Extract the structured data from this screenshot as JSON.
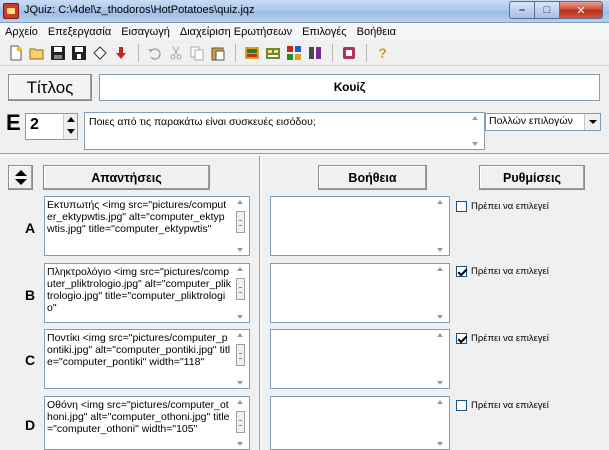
{
  "window": {
    "title": "JQuiz: C:\\4del\\z_thodoros\\HotPotatoes\\quiz.jqz",
    "min_label": "–",
    "max_label": "□",
    "close_label": "✕"
  },
  "menu": {
    "items": [
      {
        "label": "Αρχείο"
      },
      {
        "label": "Επεξεργασία"
      },
      {
        "label": "Εισαγωγή"
      },
      {
        "label": "Διαχείριση Ερωτήσεων"
      },
      {
        "label": "Επιλογές"
      },
      {
        "label": "Βοήθεια"
      }
    ]
  },
  "toolbar": {
    "icons": [
      "new-icon",
      "open-icon",
      "save-icon",
      "save-as-icon",
      "web-page-icon",
      "upload-icon",
      "undo-icon",
      "cut-icon",
      "copy-icon",
      "paste-icon",
      "export-icon",
      "config-icon",
      "hot-potatoes-icon",
      "masher-icon",
      "help-book-icon",
      "help-question-icon"
    ],
    "help_label": "?"
  },
  "title_row": {
    "label": "Τίτλος",
    "value": "Κουίζ"
  },
  "question": {
    "letter": "E",
    "number": "2",
    "text": "Ποιες από τις παρακάτω είναι συσκευές εισόδου;",
    "type": "Πολλών επιλογών"
  },
  "headers": {
    "answers": "Απαντήσεις",
    "feedback": "Βοήθεια",
    "settings": "Ρυθμίσεις"
  },
  "answers": [
    {
      "letter": "A",
      "text": "Εκτυπωτής <img src=\"pictures/computer_ektypwtis.jpg\" alt=\"computer_ektypwtis.jpg\" title=\"computer_ektypwtis\"",
      "feedback": "",
      "correct_label": "Πρέπει να επιλεγεί",
      "correct": false
    },
    {
      "letter": "B",
      "text": "Πληκτρολόγιο <img src=\"pictures/computer_pliktrologio.jpg\" alt=\"computer_pliktrologio.jpg\" title=\"computer_pliktrologio\"",
      "feedback": "",
      "correct_label": "Πρέπει να επιλεγεί",
      "correct": true
    },
    {
      "letter": "C",
      "text": "Ποντίκι <img src=\"pictures/computer_pontiki.jpg\" alt=\"computer_pontiki.jpg\" title=\"computer_pontiki\" width=\"118\"",
      "feedback": "",
      "correct_label": "Πρέπει να επιλεγεί",
      "correct": true
    },
    {
      "letter": "D",
      "text": "Οθόνη <img src=\"pictures/computer_othoni.jpg\" alt=\"computer_othoni.jpg\" title=\"computer_othoni\" width=\"105\"",
      "feedback": "",
      "correct_label": "Πρέπει να επιλεγεί",
      "correct": false
    }
  ]
}
